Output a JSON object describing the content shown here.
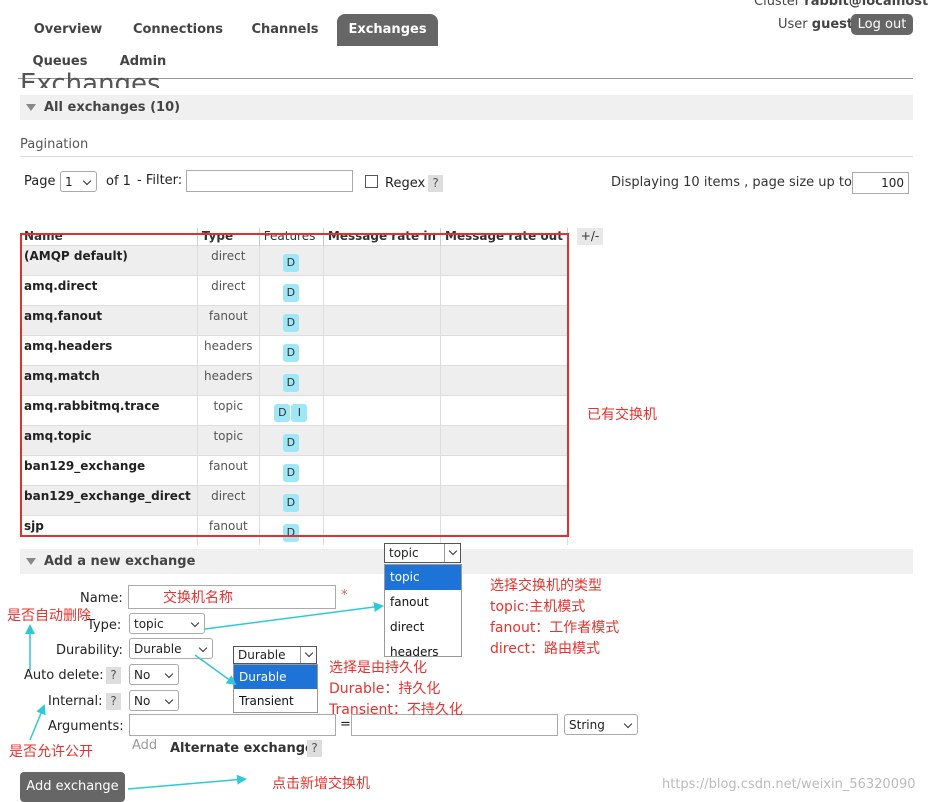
{
  "header": {
    "cluster_label": "Cluster",
    "cluster_value": "rabbit@localhost",
    "user_label": "User",
    "user_value": "guest",
    "logout_label": "Log out"
  },
  "nav": {
    "overview": "Overview",
    "connections": "Connections",
    "channels": "Channels",
    "exchanges": "Exchanges",
    "queues": "Queues",
    "admin": "Admin"
  },
  "page_title": "Exchanges",
  "all_exchanges": "All exchanges (10)",
  "pagination": {
    "heading": "Pagination",
    "page_label": "Page",
    "page_value": "1",
    "of_label": "of 1",
    "filter_label": "- Filter:",
    "filter_value": "",
    "regex_label": "Regex",
    "help": "?",
    "displaying": "Displaying 10 items , page size up to:",
    "page_size": "100"
  },
  "table": {
    "columns": [
      "Name",
      "Type",
      "Features",
      "Message rate in",
      "Message rate out"
    ],
    "plus_minus": "+/-",
    "rows": [
      {
        "name": "(AMQP default)",
        "type": "direct",
        "features": [
          "D"
        ]
      },
      {
        "name": "amq.direct",
        "type": "direct",
        "features": [
          "D"
        ]
      },
      {
        "name": "amq.fanout",
        "type": "fanout",
        "features": [
          "D"
        ]
      },
      {
        "name": "amq.headers",
        "type": "headers",
        "features": [
          "D"
        ]
      },
      {
        "name": "amq.match",
        "type": "headers",
        "features": [
          "D"
        ]
      },
      {
        "name": "amq.rabbitmq.trace",
        "type": "topic",
        "features": [
          "D",
          "I"
        ]
      },
      {
        "name": "amq.topic",
        "type": "topic",
        "features": [
          "D"
        ]
      },
      {
        "name": "ban129_exchange",
        "type": "fanout",
        "features": [
          "D"
        ]
      },
      {
        "name": "ban129_exchange_direct",
        "type": "direct",
        "features": [
          "D"
        ]
      },
      {
        "name": "sjp",
        "type": "fanout",
        "features": [
          "D"
        ]
      }
    ]
  },
  "add_exchange": {
    "heading": "Add a new exchange",
    "name_label": "Name:",
    "name_placeholder": "交换机名称",
    "required_star": "*",
    "type_label": "Type:",
    "type_value": "topic",
    "durability_label": "Durability:",
    "durability_value": "Durable",
    "auto_delete_label": "Auto delete:",
    "auto_delete_value": "No",
    "internal_label": "Internal:",
    "internal_value": "No",
    "arguments_label": "Arguments:",
    "equals": "=",
    "arg_type_value": "String",
    "add_label": "Add",
    "alternate_exchange": "Alternate exchange",
    "submit_label": "Add exchange"
  },
  "type_dropdown": {
    "current": "topic",
    "options": [
      "topic",
      "fanout",
      "direct",
      "headers"
    ],
    "selected_index": 0
  },
  "durability_dropdown": {
    "current": "Durable",
    "options": [
      "Durable",
      "Transient"
    ],
    "selected_index": 0
  },
  "annotations": {
    "existing": "已有交换机",
    "type_title": "选择交换机的类型",
    "type_topic": "topic:主机模式",
    "type_fanout": "fanout：工作者模式",
    "type_direct": "direct：路由模式",
    "auto_delete": "是否自动删除",
    "durability_title": "选择是由持久化",
    "durability_durable": "Durable：持久化",
    "durability_transient": "Transient：不持久化",
    "internal": "是否允许公开",
    "add_button": "点击新增交换机"
  },
  "watermark": "https://blog.csdn.net/weixin_56320090",
  "colors": {
    "annotation_red": "#e8322e",
    "arrow_cyan": "#2ec9d8",
    "nav_active": "#666666",
    "feature_badge": "#9fe6f6",
    "dropdown_selected": "#1e74d6"
  }
}
